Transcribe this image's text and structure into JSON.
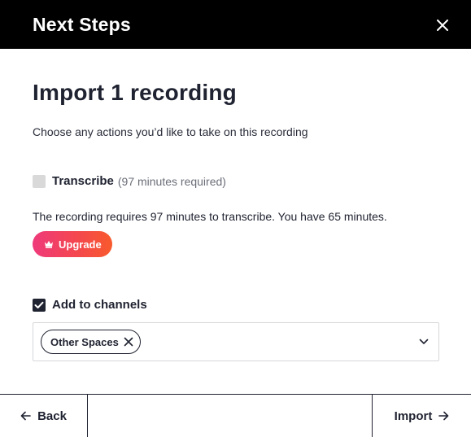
{
  "header": {
    "title": "Next Steps",
    "close_icon": "close-icon"
  },
  "main": {
    "title": "Import 1 recording",
    "subtitle": "Choose any actions you’d like to take on this recording",
    "transcribe": {
      "label": "Transcribe",
      "note": "(97 minutes required)",
      "checked": false
    },
    "notice": "The recording requires 97 minutes to transcribe. You have 65 minutes.",
    "upgrade": {
      "label": "Upgrade",
      "icon": "crown-icon",
      "gradient": [
        "#ef3a7b",
        "#f85a2c"
      ]
    },
    "channels": {
      "label": "Add to channels",
      "checked": true,
      "selected_chips": [
        "Other Spaces"
      ],
      "dropdown_icon": "chevron-down-icon"
    }
  },
  "footer": {
    "back_label": "Back",
    "import_label": "Import"
  },
  "colors": {
    "header_bg": "#000000",
    "text": "#1f2230",
    "muted": "#6b6e78"
  }
}
